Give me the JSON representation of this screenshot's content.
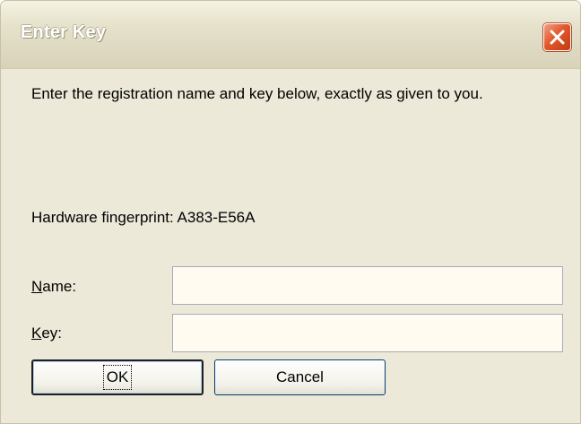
{
  "window": {
    "title": "Enter Key"
  },
  "content": {
    "prompt": "Enter the registration name and key below, exactly as given to you.",
    "fingerprint": "Hardware fingerprint: A383-E56A"
  },
  "form": {
    "name": {
      "accelerator": "N",
      "label_rest": "ame:",
      "value": ""
    },
    "key": {
      "accelerator": "K",
      "label_rest": "ey:",
      "value": ""
    }
  },
  "buttons": {
    "ok_label": "OK",
    "cancel_label": "Cancel"
  },
  "colors": {
    "dialog_background": "#ece9d8",
    "close_button": "#e2582c",
    "input_background": "#fffbf0"
  },
  "icons": {
    "close": "close-x-icon"
  }
}
